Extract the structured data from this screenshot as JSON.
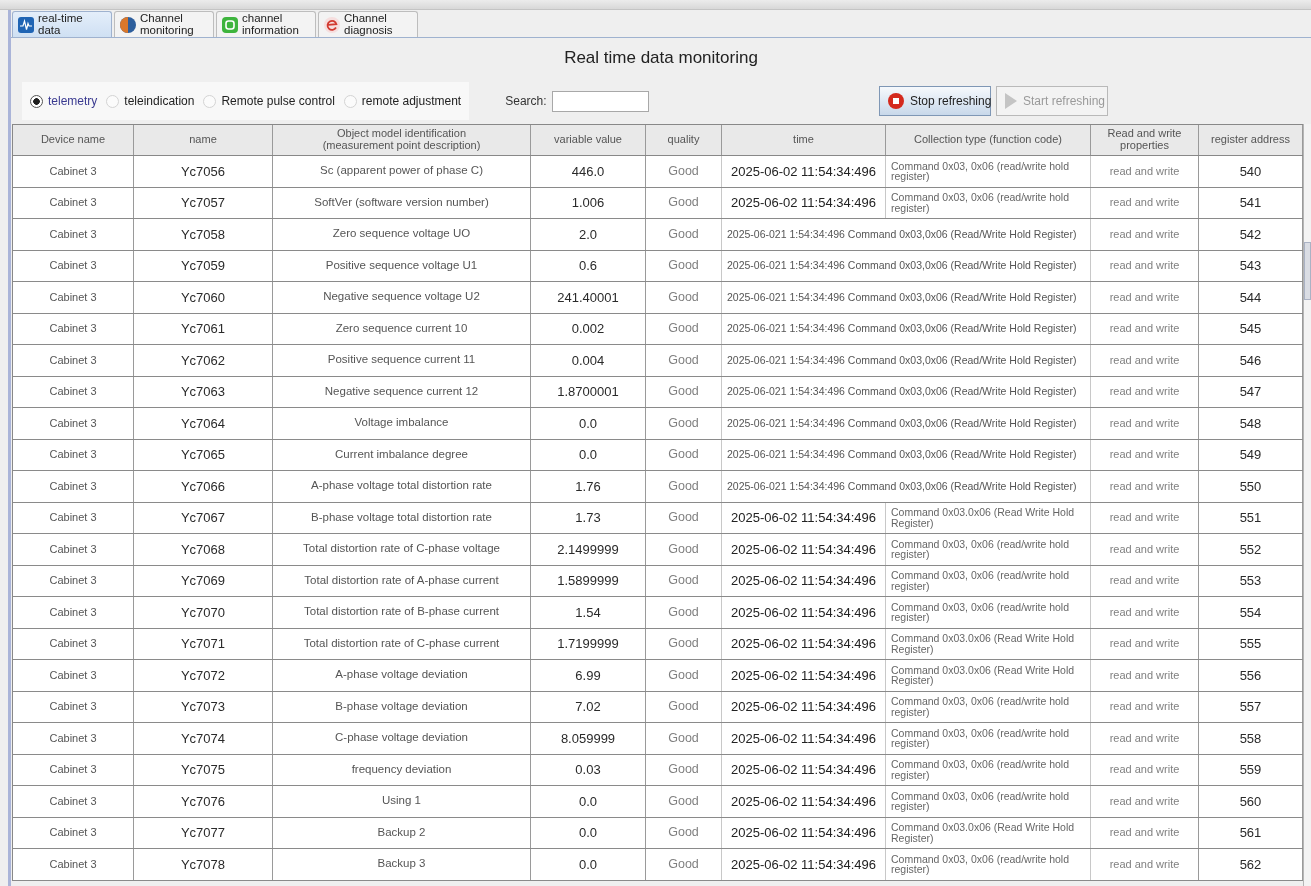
{
  "tabs": [
    {
      "label": "real-time data",
      "kind": "realtime",
      "selected": true
    },
    {
      "label": "Channel monitoring",
      "kind": "monitoring",
      "selected": false
    },
    {
      "label": "channel information",
      "kind": "information",
      "selected": false
    },
    {
      "label": "Channel diagnosis",
      "kind": "diagnosis",
      "selected": false
    }
  ],
  "title": "Real time data monitoring",
  "data_types": [
    {
      "label": "telemetry",
      "selected": true
    },
    {
      "label": "teleindication",
      "selected": false
    },
    {
      "label": "Remote pulse control",
      "selected": false
    },
    {
      "label": "remote adjustment",
      "selected": false
    }
  ],
  "search": {
    "label": "Search:"
  },
  "buttons": [
    {
      "label": "Stop refreshing",
      "kind": "stop",
      "disabled": false
    },
    {
      "label": "Start refreshing",
      "kind": "start",
      "disabled": true
    }
  ],
  "table": {
    "columns": [
      "Device name",
      "name",
      "Object model identification (measurement point description)",
      "variable value",
      "quality",
      "time",
      "Collection type (function code)",
      "Read and write properties",
      "register address"
    ],
    "rows": [
      {
        "kind": "split",
        "device": "Cabinet 3",
        "name": "Yc7056",
        "description": "Sc (apparent power of phase C)",
        "value": "446.0",
        "quality": "Good",
        "time": "2025-06-02 11:54:34:496",
        "collection_type": "Command 0x03, 0x06 (read/write hold register)",
        "access": "read and write",
        "register": "540"
      },
      {
        "kind": "split",
        "device": "Cabinet 3",
        "name": "Yc7057",
        "description": "SoftVer (software version number)",
        "value": "1.006",
        "quality": "Good",
        "time": "2025-06-02 11:54:34:496",
        "collection_type": "Command 0x03, 0x06 (read/write hold register)",
        "access": "read and write",
        "register": "541"
      },
      {
        "kind": "merged",
        "device": "Cabinet 3",
        "name": "Yc7058",
        "description": "Zero sequence voltage UO",
        "value": "2.0",
        "quality": "Good",
        "time_collection": "2025-06-021 1:54:34:496 Command 0x03,0x06 (Read/Write Hold Register)",
        "access": "read and write",
        "register": "542"
      },
      {
        "kind": "merged",
        "device": "Cabinet 3",
        "name": "Yc7059",
        "description": "Positive sequence voltage U1",
        "value": "0.6",
        "quality": "Good",
        "time_collection": "2025-06-021 1:54:34:496 Command 0x03,0x06 (Read/Write Hold Register)",
        "access": "read and write",
        "register": "543"
      },
      {
        "kind": "merged",
        "device": "Cabinet 3",
        "name": "Yc7060",
        "description": "Negative sequence voltage U2",
        "value": "241.40001",
        "quality": "Good",
        "time_collection": "2025-06-021 1:54:34:496 Command 0x03,0x06 (Read/Write Hold Register)",
        "access": "read and write",
        "register": "544"
      },
      {
        "kind": "merged",
        "device": "Cabinet 3",
        "name": "Yc7061",
        "description": "Zero sequence current 10",
        "value": "0.002",
        "quality": "Good",
        "time_collection": "2025-06-021 1:54:34:496 Command 0x03,0x06 (Read/Write Hold Register)",
        "access": "read and write",
        "register": "545"
      },
      {
        "kind": "merged",
        "device": "Cabinet 3",
        "name": "Yc7062",
        "description": "Positive sequence current 11",
        "value": "0.004",
        "quality": "Good",
        "time_collection": "2025-06-021 1:54:34:496 Command 0x03,0x06 (Read/Write Hold Register)",
        "access": "read and write",
        "register": "546"
      },
      {
        "kind": "merged",
        "device": "Cabinet 3",
        "name": "Yc7063",
        "description": "Negative sequence current 12",
        "value": "1.8700001",
        "quality": "Good",
        "time_collection": "2025-06-021 1:54:34:496 Command 0x03,0x06 (Read/Write Hold Register)",
        "access": "read and write",
        "register": "547"
      },
      {
        "kind": "merged",
        "device": "Cabinet 3",
        "name": "Yc7064",
        "description": "Voltage imbalance",
        "value": "0.0",
        "quality": "Good",
        "time_collection": "2025-06-021 1:54:34:496 Command 0x03,0x06 (Read/Write Hold Register)",
        "access": "read and write",
        "register": "548"
      },
      {
        "kind": "merged",
        "device": "Cabinet 3",
        "name": "Yc7065",
        "description": "Current imbalance degree",
        "value": "0.0",
        "quality": "Good",
        "time_collection": "2025-06-021 1:54:34:496 Command 0x03,0x06 (Read/Write Hold Register)",
        "access": "read and write",
        "register": "549"
      },
      {
        "kind": "merged",
        "device": "Cabinet 3",
        "name": "Yc7066",
        "description": "A-phase voltage total distortion rate",
        "value": "1.76",
        "quality": "Good",
        "time_collection": "2025-06-021 1:54:34:496 Command 0x03,0x06 (Read/Write Hold Register)",
        "access": "read and write",
        "register": "550"
      },
      {
        "kind": "split",
        "device": "Cabinet 3",
        "name": "Yc7067",
        "description": "B-phase voltage total distortion rate",
        "value": "1.73",
        "quality": "Good",
        "time": "2025-06-02 11:54:34:496",
        "collection_type": "Command 0x03.0x06 (Read Write Hold Register)",
        "access": "read and write",
        "register": "551"
      },
      {
        "kind": "split",
        "device": "Cabinet 3",
        "name": "Yc7068",
        "description": "Total distortion rate of C-phase voltage",
        "value": "2.1499999",
        "quality": "Good",
        "time": "2025-06-02 11:54:34:496",
        "collection_type": "Command 0x03, 0x06 (read/write hold register)",
        "access": "read and write",
        "register": "552"
      },
      {
        "kind": "split",
        "device": "Cabinet 3",
        "name": "Yc7069",
        "description": "Total distortion rate of A-phase current",
        "value": "1.5899999",
        "quality": "Good",
        "time": "2025-06-02 11:54:34:496",
        "collection_type": "Command 0x03, 0x06 (read/write hold register)",
        "access": "read and write",
        "register": "553"
      },
      {
        "kind": "split",
        "device": "Cabinet 3",
        "name": "Yc7070",
        "description": "Total distortion rate of B-phase current",
        "value": "1.54",
        "quality": "Good",
        "time": "2025-06-02 11:54:34:496",
        "collection_type": "Command 0x03, 0x06 (read/write hold register)",
        "access": "read and write",
        "register": "554"
      },
      {
        "kind": "split",
        "device": "Cabinet 3",
        "name": "Yc7071",
        "description": "Total distortion rate of C-phase current",
        "value": "1.7199999",
        "quality": "Good",
        "time": "2025-06-02 11:54:34:496",
        "collection_type": "Command 0x03.0x06 (Read Write Hold Register)",
        "access": "read and write",
        "register": "555"
      },
      {
        "kind": "split",
        "device": "Cabinet 3",
        "name": "Yc7072",
        "description": "A-phase voltage deviation",
        "value": "6.99",
        "quality": "Good",
        "time": "2025-06-02 11:54:34:496",
        "collection_type": "Command 0x03.0x06 (Read Write Hold Register)",
        "access": "read and write",
        "register": "556"
      },
      {
        "kind": "split",
        "device": "Cabinet 3",
        "name": "Yc7073",
        "description": "B-phase voltage deviation",
        "value": "7.02",
        "quality": "Good",
        "time": "2025-06-02 11:54:34:496",
        "collection_type": "Command 0x03, 0x06 (read/write hold register)",
        "access": "read and write",
        "register": "557"
      },
      {
        "kind": "split",
        "device": "Cabinet 3",
        "name": "Yc7074",
        "description": "C-phase voltage deviation",
        "value": "8.059999",
        "quality": "Good",
        "time": "2025-06-02 11:54:34:496",
        "collection_type": "Command 0x03, 0x06 (read/write hold register)",
        "access": "read and write",
        "register": "558"
      },
      {
        "kind": "split",
        "device": "Cabinet 3",
        "name": "Yc7075",
        "description": "frequency deviation",
        "value": "0.03",
        "quality": "Good",
        "time": "2025-06-02 11:54:34:496",
        "collection_type": "Command 0x03, 0x06 (read/write hold register)",
        "access": "read and write",
        "register": "559"
      },
      {
        "kind": "split",
        "device": "Cabinet 3",
        "name": "Yc7076",
        "description": "Using 1",
        "value": "0.0",
        "quality": "Good",
        "time": "2025-06-02 11:54:34:496",
        "collection_type": "Command 0x03, 0x06 (read/write hold register)",
        "access": "read and write",
        "register": "560"
      },
      {
        "kind": "split",
        "device": "Cabinet 3",
        "name": "Yc7077",
        "description": "Backup 2",
        "value": "0.0",
        "quality": "Good",
        "time": "2025-06-02 11:54:34:496",
        "collection_type": "Command 0x03.0x06 (Read Write Hold Register)",
        "access": "read and write",
        "register": "561"
      },
      {
        "kind": "split",
        "device": "Cabinet 3",
        "name": "Yc7078",
        "description": "Backup 3",
        "value": "0.0",
        "quality": "Good",
        "time": "2025-06-02 11:54:34:496",
        "collection_type": "Command 0x03, 0x06 (read/write hold register)",
        "access": "read and write",
        "register": "562"
      }
    ]
  }
}
